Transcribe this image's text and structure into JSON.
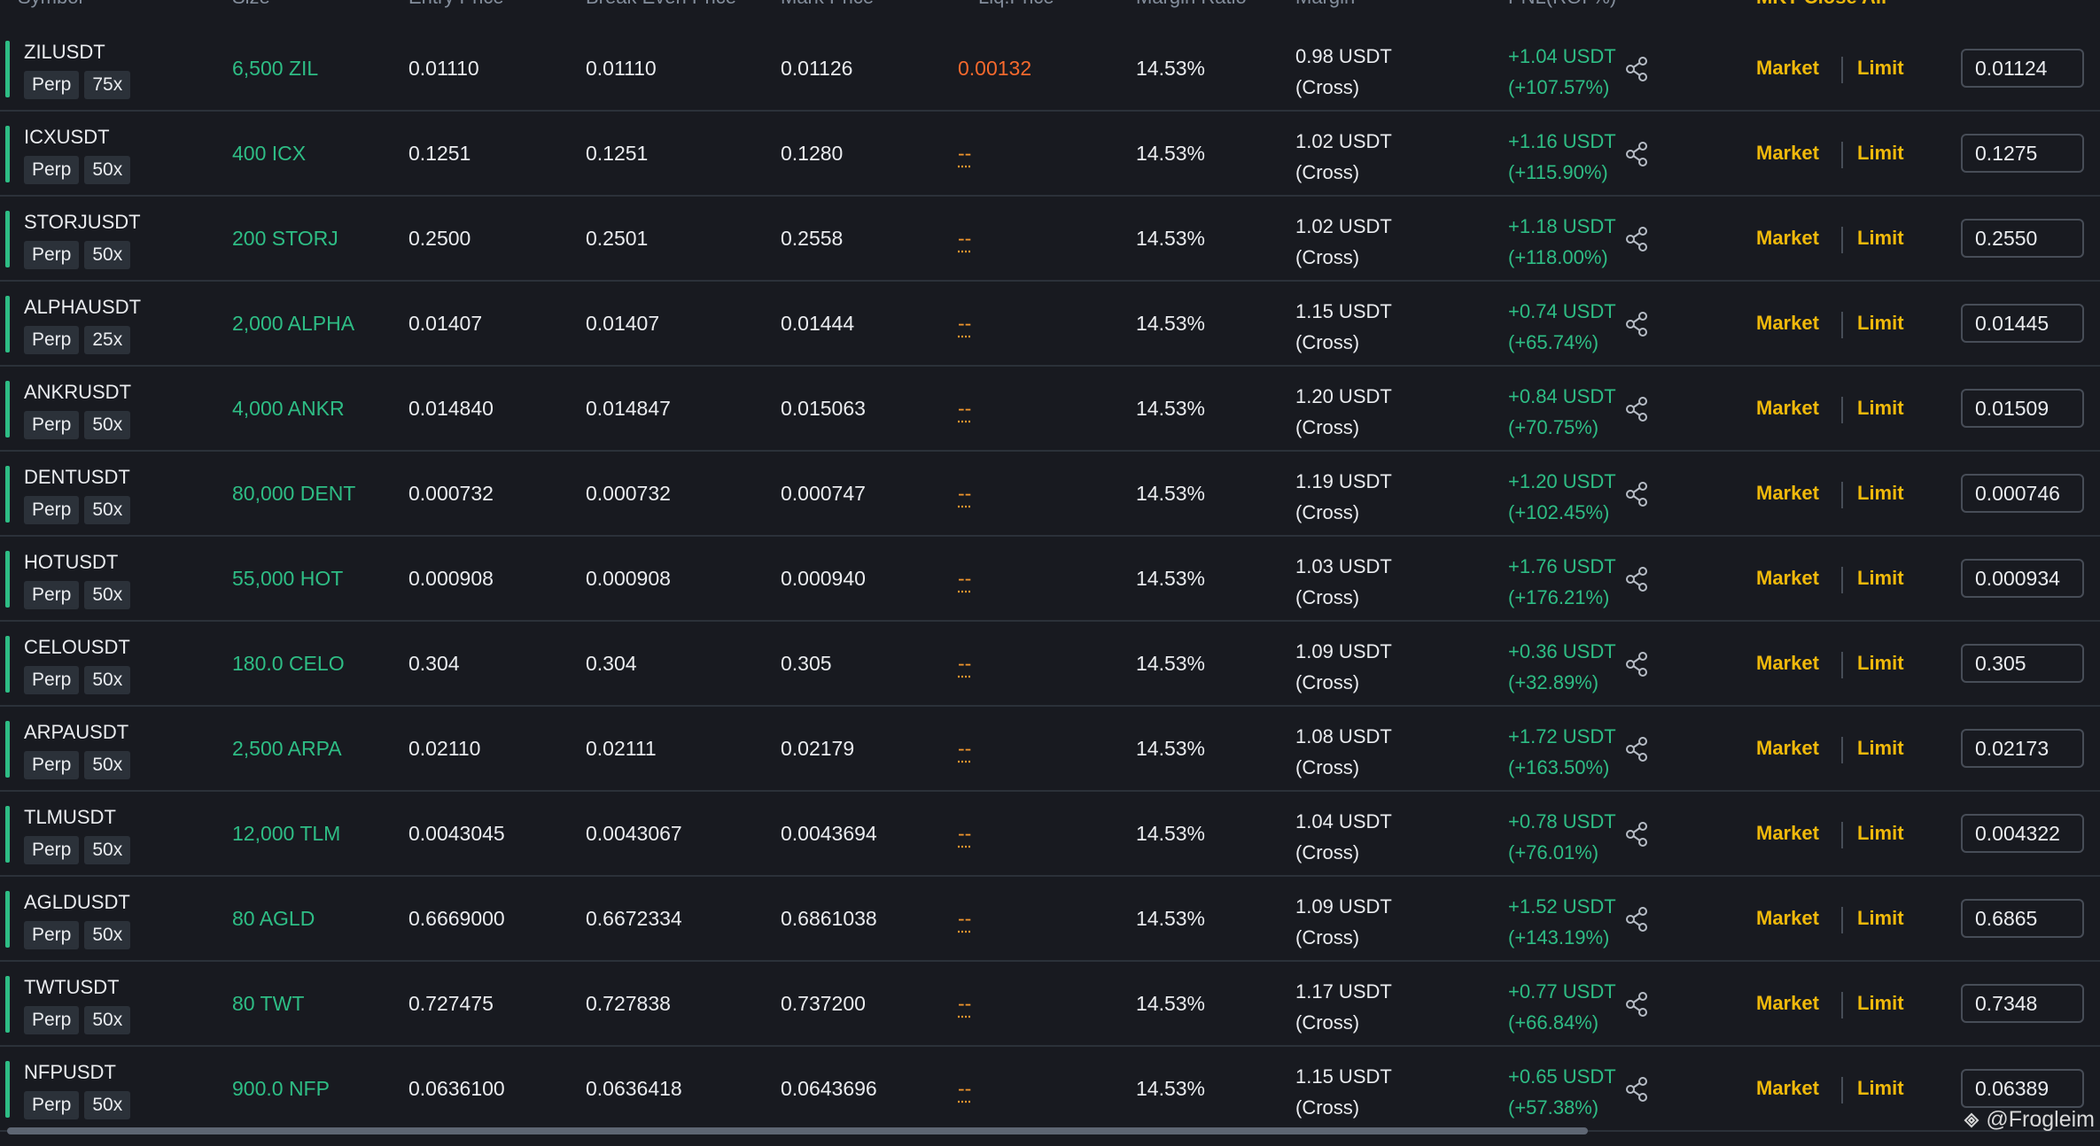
{
  "header": {
    "symbol": "Symbol",
    "size": "Size",
    "entry_price": "Entry Price",
    "break_even_price": "Break Even Price",
    "mark_price": "Mark Price",
    "liq_price": "Liq.Price",
    "margin_ratio": "Margin Ratio",
    "margin": "Margin",
    "pnl": "PNL(ROI %)",
    "close_all": "MKT Close All"
  },
  "actions": {
    "market": "Market",
    "limit": "Limit"
  },
  "watermark": "@Frogleim",
  "colors": {
    "background": "#181a20",
    "profit": "#2ebd85",
    "accent": "#f0b90b",
    "liquidation": "#f6692d"
  },
  "rows": [
    {
      "symbol": "ZILUSDT",
      "type": "Perp",
      "leverage": "75x",
      "size": "6,500 ZIL",
      "entry": "0.01110",
      "break_even": "0.01110",
      "mark": "0.01126",
      "liq": "0.00132",
      "liq_dash": false,
      "ratio": "14.53%",
      "margin": "0.98 USDT",
      "margin_mode": "(Cross)",
      "pnl": "+1.04 USDT",
      "roi": "(+107.57%)",
      "price": "0.01124"
    },
    {
      "symbol": "ICXUSDT",
      "type": "Perp",
      "leverage": "50x",
      "size": "400 ICX",
      "entry": "0.1251",
      "break_even": "0.1251",
      "mark": "0.1280",
      "liq": "--",
      "liq_dash": true,
      "ratio": "14.53%",
      "margin": "1.02 USDT",
      "margin_mode": "(Cross)",
      "pnl": "+1.16 USDT",
      "roi": "(+115.90%)",
      "price": "0.1275"
    },
    {
      "symbol": "STORJUSDT",
      "type": "Perp",
      "leverage": "50x",
      "size": "200 STORJ",
      "entry": "0.2500",
      "break_even": "0.2501",
      "mark": "0.2558",
      "liq": "--",
      "liq_dash": true,
      "ratio": "14.53%",
      "margin": "1.02 USDT",
      "margin_mode": "(Cross)",
      "pnl": "+1.18 USDT",
      "roi": "(+118.00%)",
      "price": "0.2550"
    },
    {
      "symbol": "ALPHAUSDT",
      "type": "Perp",
      "leverage": "25x",
      "size": "2,000 ALPHA",
      "entry": "0.01407",
      "break_even": "0.01407",
      "mark": "0.01444",
      "liq": "--",
      "liq_dash": true,
      "ratio": "14.53%",
      "margin": "1.15 USDT",
      "margin_mode": "(Cross)",
      "pnl": "+0.74 USDT",
      "roi": "(+65.74%)",
      "price": "0.01445"
    },
    {
      "symbol": "ANKRUSDT",
      "type": "Perp",
      "leverage": "50x",
      "size": "4,000 ANKR",
      "entry": "0.014840",
      "break_even": "0.014847",
      "mark": "0.015063",
      "liq": "--",
      "liq_dash": true,
      "ratio": "14.53%",
      "margin": "1.20 USDT",
      "margin_mode": "(Cross)",
      "pnl": "+0.84 USDT",
      "roi": "(+70.75%)",
      "price": "0.01509"
    },
    {
      "symbol": "DENTUSDT",
      "type": "Perp",
      "leverage": "50x",
      "size": "80,000 DENT",
      "entry": "0.000732",
      "break_even": "0.000732",
      "mark": "0.000747",
      "liq": "--",
      "liq_dash": true,
      "ratio": "14.53%",
      "margin": "1.19 USDT",
      "margin_mode": "(Cross)",
      "pnl": "+1.20 USDT",
      "roi": "(+102.45%)",
      "price": "0.000746"
    },
    {
      "symbol": "HOTUSDT",
      "type": "Perp",
      "leverage": "50x",
      "size": "55,000 HOT",
      "entry": "0.000908",
      "break_even": "0.000908",
      "mark": "0.000940",
      "liq": "--",
      "liq_dash": true,
      "ratio": "14.53%",
      "margin": "1.03 USDT",
      "margin_mode": "(Cross)",
      "pnl": "+1.76 USDT",
      "roi": "(+176.21%)",
      "price": "0.000934"
    },
    {
      "symbol": "CELOUSDT",
      "type": "Perp",
      "leverage": "50x",
      "size": "180.0 CELO",
      "entry": "0.304",
      "break_even": "0.304",
      "mark": "0.305",
      "liq": "--",
      "liq_dash": true,
      "ratio": "14.53%",
      "margin": "1.09 USDT",
      "margin_mode": "(Cross)",
      "pnl": "+0.36 USDT",
      "roi": "(+32.89%)",
      "price": "0.305"
    },
    {
      "symbol": "ARPAUSDT",
      "type": "Perp",
      "leverage": "50x",
      "size": "2,500 ARPA",
      "entry": "0.02110",
      "break_even": "0.02111",
      "mark": "0.02179",
      "liq": "--",
      "liq_dash": true,
      "ratio": "14.53%",
      "margin": "1.08 USDT",
      "margin_mode": "(Cross)",
      "pnl": "+1.72 USDT",
      "roi": "(+163.50%)",
      "price": "0.02173"
    },
    {
      "symbol": "TLMUSDT",
      "type": "Perp",
      "leverage": "50x",
      "size": "12,000 TLM",
      "entry": "0.0043045",
      "break_even": "0.0043067",
      "mark": "0.0043694",
      "liq": "--",
      "liq_dash": true,
      "ratio": "14.53%",
      "margin": "1.04 USDT",
      "margin_mode": "(Cross)",
      "pnl": "+0.78 USDT",
      "roi": "(+76.01%)",
      "price": "0.004322"
    },
    {
      "symbol": "AGLDUSDT",
      "type": "Perp",
      "leverage": "50x",
      "size": "80 AGLD",
      "entry": "0.6669000",
      "break_even": "0.6672334",
      "mark": "0.6861038",
      "liq": "--",
      "liq_dash": true,
      "ratio": "14.53%",
      "margin": "1.09 USDT",
      "margin_mode": "(Cross)",
      "pnl": "+1.52 USDT",
      "roi": "(+143.19%)",
      "price": "0.6865"
    },
    {
      "symbol": "TWTUSDT",
      "type": "Perp",
      "leverage": "50x",
      "size": "80 TWT",
      "entry": "0.727475",
      "break_even": "0.727838",
      "mark": "0.737200",
      "liq": "--",
      "liq_dash": true,
      "ratio": "14.53%",
      "margin": "1.17 USDT",
      "margin_mode": "(Cross)",
      "pnl": "+0.77 USDT",
      "roi": "(+66.84%)",
      "price": "0.7348"
    },
    {
      "symbol": "NFPUSDT",
      "type": "Perp",
      "leverage": "50x",
      "size": "900.0 NFP",
      "entry": "0.0636100",
      "break_even": "0.0636418",
      "mark": "0.0643696",
      "liq": "--",
      "liq_dash": true,
      "ratio": "14.53%",
      "margin": "1.15 USDT",
      "margin_mode": "(Cross)",
      "pnl": "+0.65 USDT",
      "roi": "(+57.38%)",
      "price": "0.06389"
    }
  ]
}
